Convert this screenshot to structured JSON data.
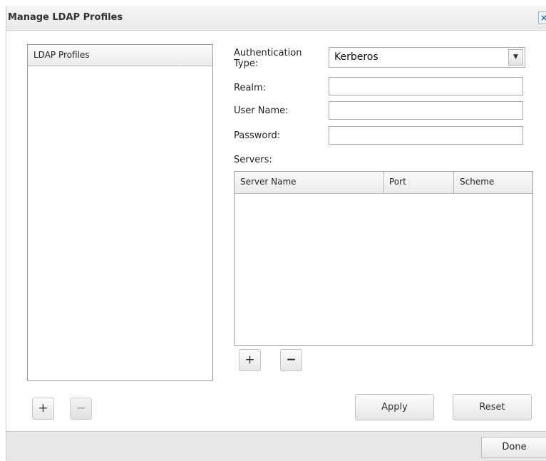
{
  "dialog": {
    "title": "Manage LDAP Profiles",
    "close_glyph": "×"
  },
  "profiles_panel": {
    "header": "LDAP Profiles",
    "items": [],
    "add_glyph": "+",
    "remove_glyph": "−"
  },
  "form": {
    "auth_type_label": "Authentication Type:",
    "auth_type_value": "Kerberos",
    "realm_label": "Realm:",
    "realm_value": "",
    "username_label": "User Name:",
    "username_value": "",
    "password_label": "Password:",
    "password_value": "",
    "servers_label": "Servers:"
  },
  "servers_table": {
    "columns": [
      "Server Name",
      "Port",
      "Scheme"
    ],
    "rows": [],
    "add_glyph": "+",
    "remove_glyph": "−"
  },
  "buttons": {
    "apply": "Apply",
    "reset": "Reset",
    "done": "Done"
  },
  "icons": {
    "dropdown": "chevron-down-icon",
    "close": "close-icon"
  }
}
